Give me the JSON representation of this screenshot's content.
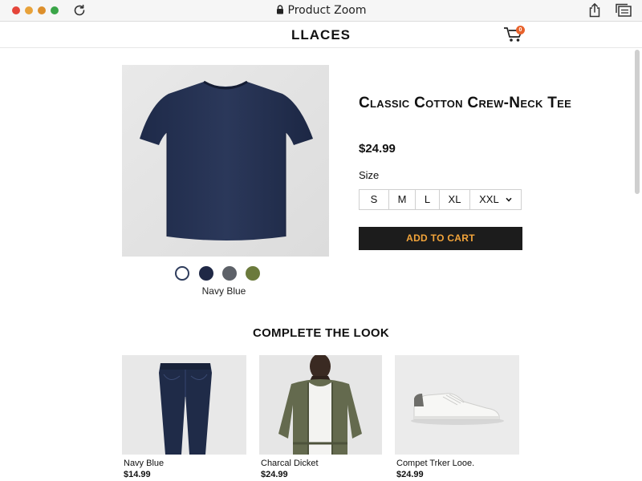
{
  "browser": {
    "title": "Product Zoom",
    "icons": [
      "reload-icon",
      "lock-icon",
      "share-icon",
      "tabs-icon"
    ]
  },
  "header": {
    "brand": "LLACES",
    "cart_count": "0",
    "cart_icon": "shopping-cart-icon"
  },
  "product": {
    "image_icon": "navy-tshirt-photo",
    "title": "Classic Cotton Crew-Neck Tee",
    "price": "$24.99",
    "size_label": "Size",
    "sizes": [
      "S",
      "M",
      "L",
      "XL",
      "XXL"
    ],
    "add_to_cart_label": "ADD TO CART",
    "swatches": [
      {
        "color": "#ffffff"
      },
      {
        "color": "#1f2846"
      },
      {
        "color": "#5d6168"
      },
      {
        "color": "#6b7a3c"
      }
    ],
    "selected_color": "Navy Blue"
  },
  "complete_the_look": {
    "title": "COMPLETE THE LOOK",
    "items": [
      {
        "name": "Navy Blue",
        "price": "$14.99",
        "image_icon": "dark-jeans-photo"
      },
      {
        "name": "Charcal Dicket",
        "price": "$24.99",
        "image_icon": "olive-bomber-jacket-photo"
      },
      {
        "name": "Compet Trker Looe.",
        "price": "$24.99",
        "image_icon": "white-sneaker-photo"
      }
    ]
  },
  "colors": {
    "accent": "#f2a43a",
    "button_bg": "#1c1c1c",
    "cart_badge": "#e8622c"
  }
}
